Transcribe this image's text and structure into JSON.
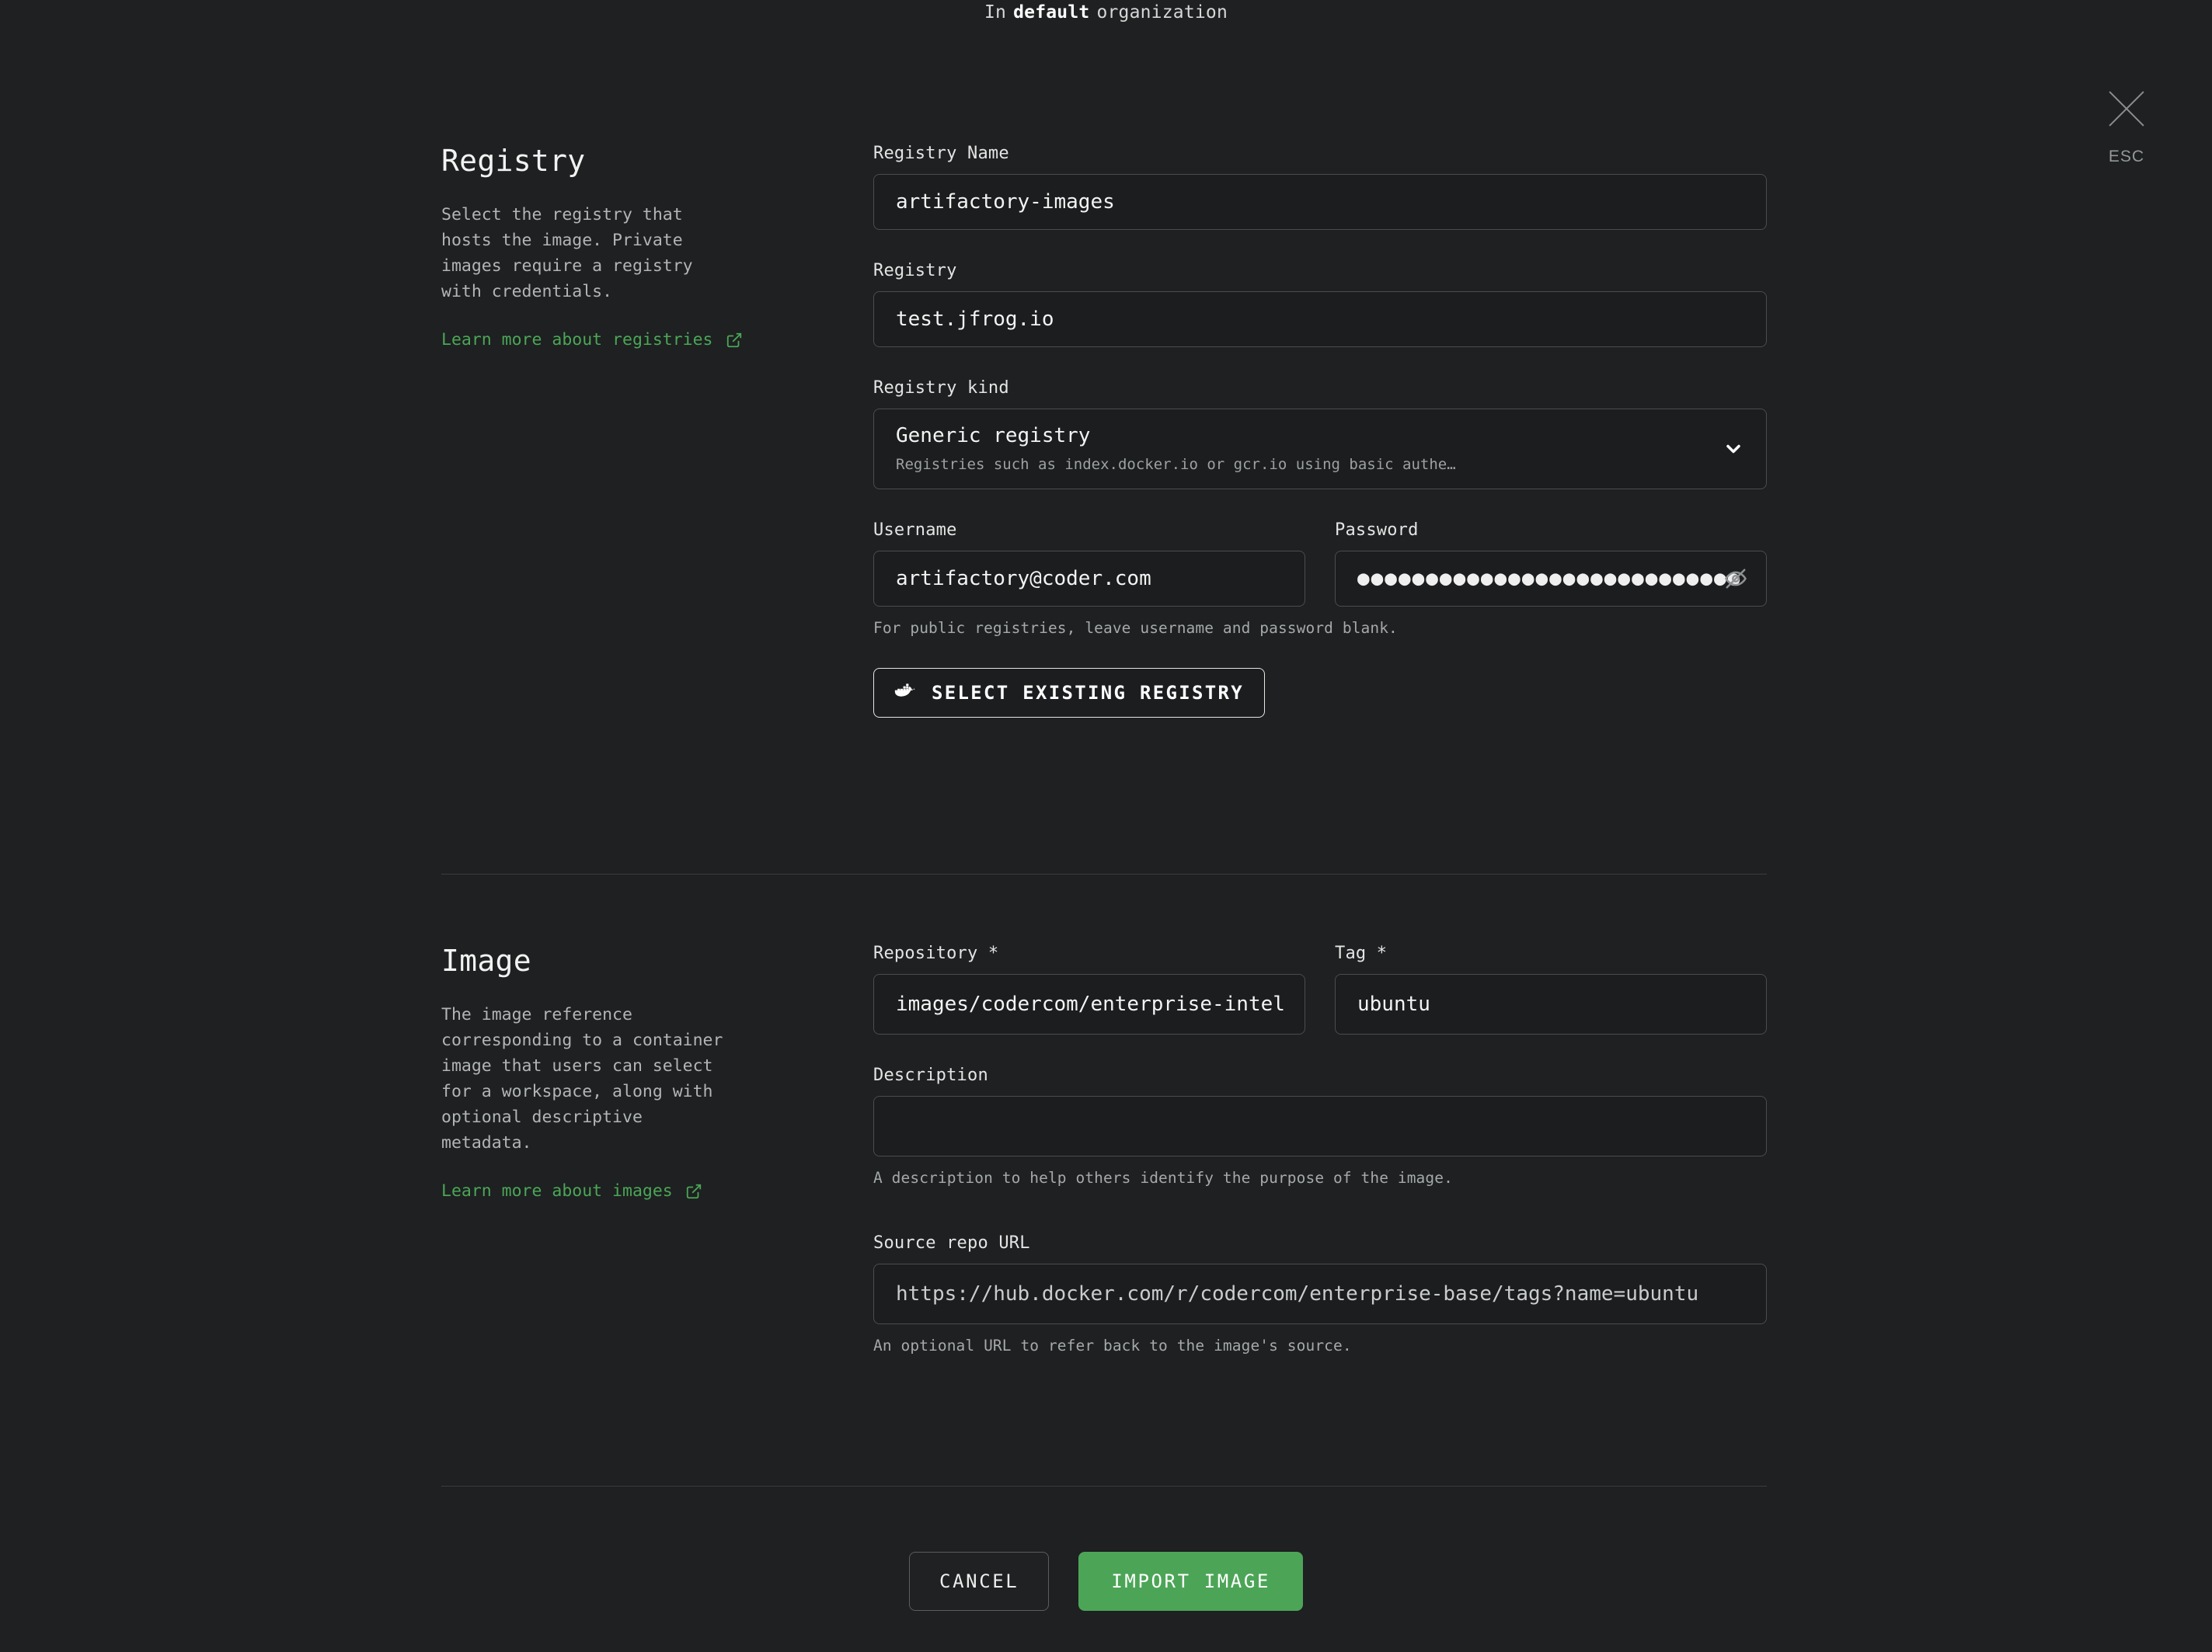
{
  "banner": {
    "prefix": "In",
    "org": "default",
    "suffix": "organization"
  },
  "close": {
    "label": "ESC",
    "icon": "close-icon"
  },
  "registry_section": {
    "title": "Registry",
    "description": "Select the registry that hosts the image. Private images require a registry with credentials.",
    "learn_more": "Learn more about registries",
    "fields": {
      "registry_name_label": "Registry Name",
      "registry_name_value": "artifactory-images",
      "registry_label": "Registry",
      "registry_value": "test.jfrog.io",
      "registry_kind_label": "Registry kind",
      "registry_kind_value": "Generic registry",
      "registry_kind_subtitle": "Registries such as index.docker.io or gcr.io using basic authe…",
      "username_label": "Username",
      "username_value": "artifactory@coder.com",
      "password_label": "Password",
      "password_value": "●●●●●●●●●●●●●●●●●●●●●●●●●●●●",
      "credentials_helper": "For public registries, leave username and password blank."
    },
    "select_registry_button": "SELECT EXISTING REGISTRY"
  },
  "image_section": {
    "title": "Image",
    "description": "The image reference corresponding to a container image that users can select for a workspace, along with optional descriptive metadata.",
    "learn_more": "Learn more about images",
    "fields": {
      "repository_label": "Repository *",
      "repository_value": "images/codercom/enterprise-intel",
      "tag_label": "Tag *",
      "tag_value": "ubuntu",
      "description_label": "Description",
      "description_value": "",
      "description_helper": "A description to help others identify the purpose of the image.",
      "source_url_label": "Source repo URL",
      "source_url_value": "https://hub.docker.com/r/codercom/enterprise-base/tags?name=ubuntu",
      "source_url_helper": "An optional URL to refer back to the image's source."
    }
  },
  "footer": {
    "cancel_label": "CANCEL",
    "import_label": "IMPORT IMAGE"
  },
  "colors": {
    "background": "#1E2021",
    "accent_green": "#4CA557",
    "link_green": "#4BA657",
    "field_background": "#1B1D1E",
    "field_border": "#4A4D4E"
  }
}
